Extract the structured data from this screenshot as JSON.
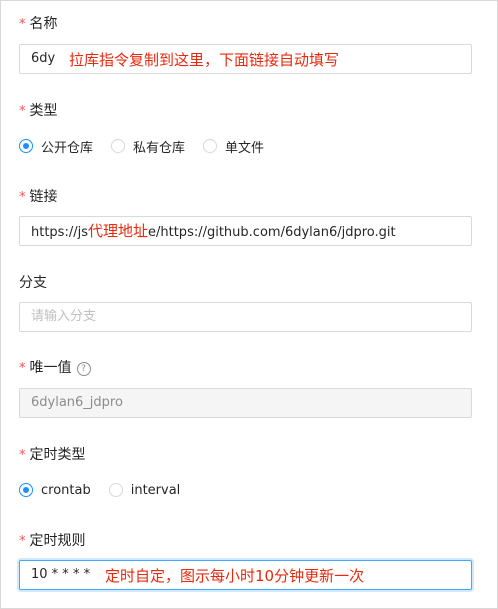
{
  "form": {
    "name": {
      "required": "*",
      "label": "名称",
      "value": "6dy",
      "annotation": "拉库指令复制到这里，下面链接自动填写"
    },
    "type": {
      "required": "*",
      "label": "类型",
      "options": [
        "公开仓库",
        "私有仓库",
        "单文件"
      ],
      "selected": "公开仓库"
    },
    "link": {
      "required": "*",
      "label": "链接",
      "value_prefix": "https://js",
      "annotation": "代理地址",
      "value_suffix": "e/https://github.com/6dylan6/jdpro.git"
    },
    "branch": {
      "label": "分支",
      "placeholder": "请输入分支"
    },
    "unique": {
      "required": "*",
      "label": "唯一值",
      "help_icon": "?",
      "value": "6dylan6_jdpro"
    },
    "schedule_type": {
      "required": "*",
      "label": "定时类型",
      "options": [
        "crontab",
        "interval"
      ],
      "selected": "crontab"
    },
    "schedule_rule": {
      "required": "*",
      "label": "定时规则",
      "value": "10 * * * *",
      "annotation": "定时自定，图示每小时10分钟更新一次"
    }
  },
  "colors": {
    "required": "#ff4d4f",
    "annotation": "#e8290d",
    "primary": "#1890ff",
    "border": "#d9d9d9"
  }
}
